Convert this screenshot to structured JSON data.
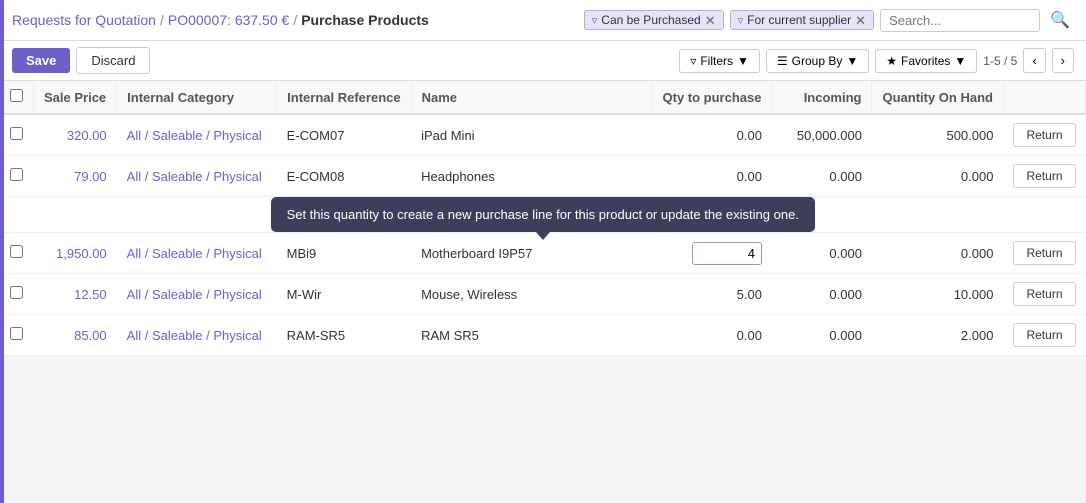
{
  "breadcrumb": {
    "part1": "Requests for Quotation",
    "separator1": "/",
    "part2": "PO00007: 637.50 €",
    "separator2": "/",
    "part3": "Purchase Products"
  },
  "filters": [
    {
      "label": "Can be Purchased",
      "id": "filter-purchased"
    },
    {
      "label": "For current supplier",
      "id": "filter-supplier"
    }
  ],
  "search": {
    "placeholder": "Search..."
  },
  "toolbar": {
    "save_label": "Save",
    "discard_label": "Discard",
    "filters_label": "Filters",
    "group_by_label": "Group By",
    "favorites_label": "Favorites",
    "pagination": "1-5 / 5"
  },
  "table": {
    "headers": {
      "sale_price": "Sale Price",
      "internal_category": "Internal Category",
      "internal_reference": "Internal Reference",
      "name": "Name",
      "qty_to_purchase": "Qty to purchase",
      "incoming": "Incoming",
      "quantity_on_hand": "Quantity On Hand",
      "action": ""
    },
    "rows": [
      {
        "checked": false,
        "sale_price": "320.00",
        "internal_category": "All / Saleable / Physical",
        "internal_reference": "E-COM07",
        "name": "iPad Mini",
        "qty_to_purchase": "0.00",
        "incoming": "50,000.000",
        "quantity_on_hand": "500.000",
        "action": "Return"
      },
      {
        "checked": false,
        "sale_price": "79.00",
        "internal_category": "All / Saleable / Physical",
        "internal_reference": "E-COM08",
        "name": "Headphones",
        "qty_to_purchase": "0.00",
        "incoming": "0.000",
        "quantity_on_hand": "0.000",
        "action": "Return",
        "has_tooltip": true
      },
      {
        "checked": false,
        "sale_price": "1,950.00",
        "internal_category": "All / Saleable / Physical",
        "internal_reference": "MBi9",
        "name": "Motherboard I9P57",
        "qty_to_purchase": "4",
        "qty_editing": true,
        "incoming": "0.000",
        "quantity_on_hand": "0.000",
        "action": "Return"
      },
      {
        "checked": false,
        "sale_price": "12.50",
        "internal_category": "All / Saleable / Physical",
        "internal_reference": "M-Wir",
        "name": "Mouse, Wireless",
        "qty_to_purchase": "5.00",
        "incoming": "0.000",
        "quantity_on_hand": "10.000",
        "action": "Return"
      },
      {
        "checked": false,
        "sale_price": "85.00",
        "internal_category": "All / Saleable / Physical",
        "internal_reference": "RAM-SR5",
        "name": "RAM SR5",
        "qty_to_purchase": "0.00",
        "incoming": "0.000",
        "quantity_on_hand": "2.000",
        "action": "Return"
      }
    ],
    "tooltip_text": "Set this quantity to create a new purchase line for this product or update the existing one."
  }
}
